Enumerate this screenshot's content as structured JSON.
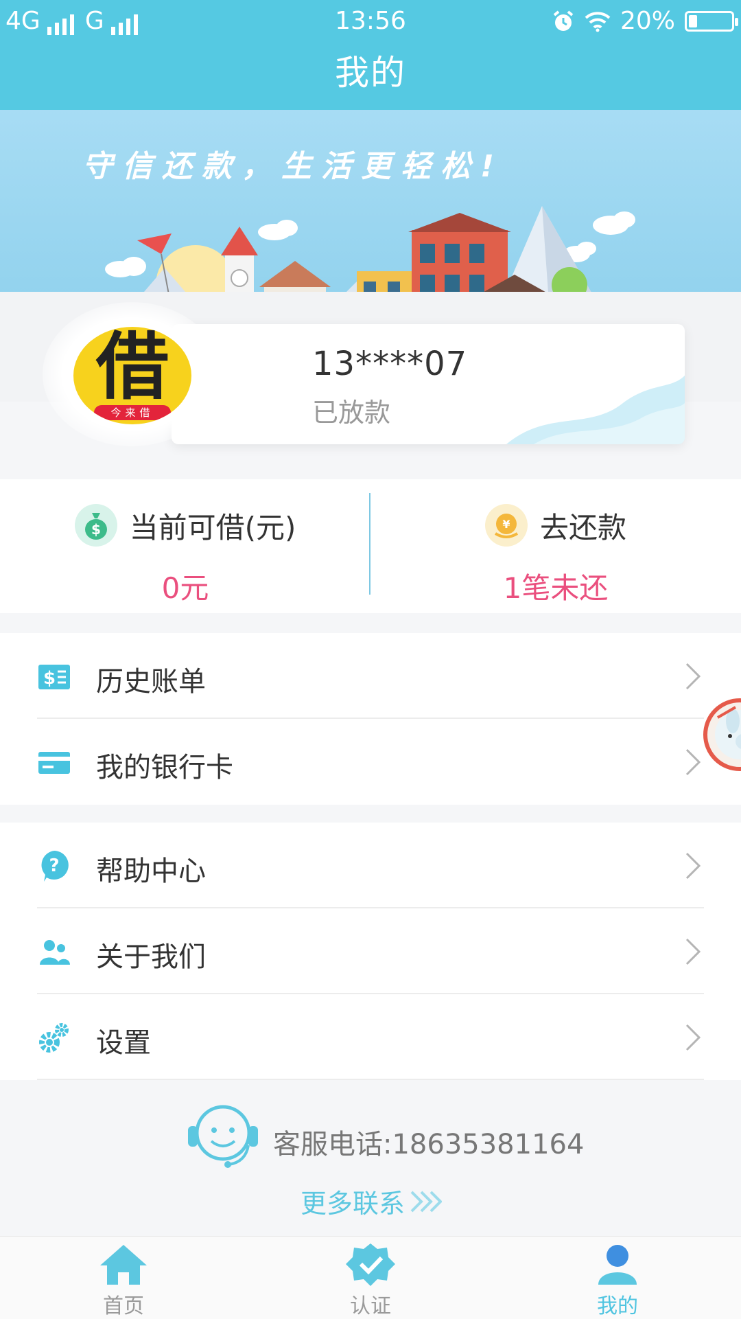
{
  "status_bar": {
    "network": "4G",
    "network2": "G",
    "time": "13:56",
    "battery": "20%",
    "battery_level": 0.2
  },
  "header": {
    "title": "我的"
  },
  "banner": {
    "slogan": "守信还款，生活更轻松!"
  },
  "profile": {
    "avatar_char": "借",
    "avatar_ribbon": "今来借",
    "phone": "13****07",
    "status": "已放款"
  },
  "stats": {
    "available": {
      "label": "当前可借(元)",
      "value": "0元"
    },
    "repay": {
      "label": "去还款",
      "value": "1笔未还"
    }
  },
  "menu": {
    "group1": [
      {
        "label": "历史账单",
        "icon": "bill-icon"
      },
      {
        "label": "我的银行卡",
        "icon": "bank-card-icon"
      }
    ],
    "group2": [
      {
        "label": "帮助中心",
        "icon": "help-icon"
      },
      {
        "label": "关于我们",
        "icon": "about-us-icon"
      },
      {
        "label": "设置",
        "icon": "settings-icon"
      }
    ]
  },
  "service": {
    "phone_text": "客服电话:18635381164",
    "more_text": "更多联系"
  },
  "tabbar": {
    "tabs": [
      {
        "label": "首页",
        "icon": "home-icon"
      },
      {
        "label": "认证",
        "icon": "verify-icon"
      },
      {
        "label": "我的",
        "icon": "user-icon",
        "active": true
      }
    ]
  },
  "colors": {
    "header": "#55c9e2",
    "accent": "#4fc4e0",
    "value_pink": "#ea4f7e"
  }
}
